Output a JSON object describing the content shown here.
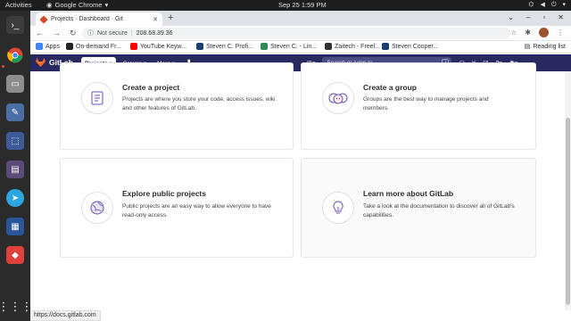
{
  "system": {
    "activities": "Activities",
    "app_name": "Google Chrome",
    "clock": "Sep 25  1:59 PM"
  },
  "browser": {
    "tab_title": "Projects · Dashboard · Git",
    "address_security": "Not secure",
    "address_url": "208.68.39.36",
    "bookmarks": [
      {
        "label": "Apps",
        "color": "#4285f4"
      },
      {
        "label": "On-demand Fr...",
        "color": "#222222"
      },
      {
        "label": "YouTube Keyw...",
        "color": "#ff0000"
      },
      {
        "label": "Steven C. Profi...",
        "color": "#1a3e6e"
      },
      {
        "label": "Steven C. - Lin...",
        "color": "#2e8b57"
      },
      {
        "label": "Zaitech - Freel...",
        "color": "#333333"
      },
      {
        "label": "Steven Cooper...",
        "color": "#1a3e6e"
      }
    ],
    "reading_list": "Reading list",
    "status_url": "https://docs.gitlab.com"
  },
  "gitlab": {
    "logo_text": "GitLab",
    "nav": [
      {
        "label": "Projects ▾",
        "active": true
      },
      {
        "label": "Groups ▾",
        "active": false
      },
      {
        "label": "More ▾",
        "active": false
      }
    ],
    "search_placeholder": "Search or jump to...",
    "accent": "#292961"
  },
  "cards": [
    {
      "title": "Create a project",
      "desc": "Projects are where you store your code, access issues, wiki and other features of GitLab.",
      "icon": "project-icon"
    },
    {
      "title": "Create a group",
      "desc": "Groups are the best way to manage projects and members.",
      "icon": "group-icon"
    },
    {
      "title": "Explore public projects",
      "desc": "Public projects are an easy way to allow everyone to have read-only access.",
      "icon": "globe-icon"
    },
    {
      "title": "Learn more about GitLab",
      "desc": "Take a look at the documentation to discover all of GitLab's capabilities.",
      "icon": "lightbulb-icon"
    }
  ]
}
